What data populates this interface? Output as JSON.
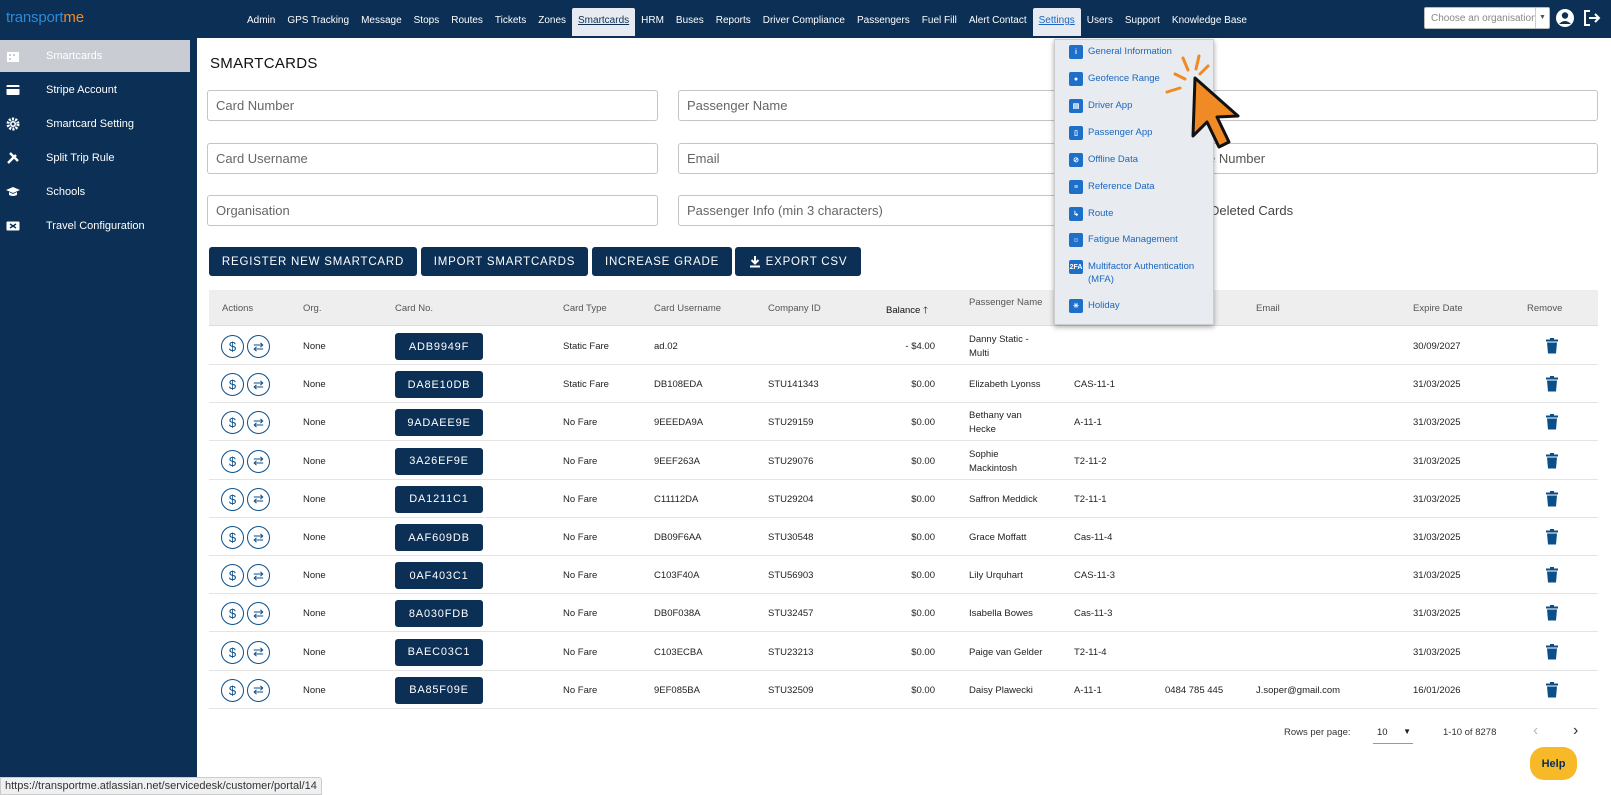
{
  "app": {
    "logo_a": "transport",
    "logo_b": "me"
  },
  "nav": [
    "Admin",
    "GPS Tracking",
    "Message",
    "Stops",
    "Routes",
    "Tickets",
    "Zones",
    "Smartcards",
    "HRM",
    "Buses",
    "Reports",
    "Driver Compliance",
    "Passengers",
    "Fuel Fill",
    "Alert Contact",
    "Settings",
    "Users",
    "Support",
    "Knowledge Base"
  ],
  "org_select": {
    "placeholder": "Choose an organisation"
  },
  "sidebar": [
    {
      "label": "Smartcards",
      "icon": "building-icon"
    },
    {
      "label": "Stripe Account",
      "icon": "credit-card-icon"
    },
    {
      "label": "Smartcard Setting",
      "icon": "gear-icon"
    },
    {
      "label": "Split Trip Rule",
      "icon": "tools-icon"
    },
    {
      "label": "Schools",
      "icon": "graduation-cap-icon"
    },
    {
      "label": "Travel Configuration",
      "icon": "ticket-icon"
    }
  ],
  "page_title": "SMARTCARDS",
  "filters": {
    "card_number": "Card Number",
    "passenger_name": "Passenger Name",
    "card_username": "Card Username",
    "email": "Email",
    "number_suffix": "e Number",
    "organisation": "Organisation",
    "passenger_info": "Passenger Info (min 3 characters)",
    "deleted_cards": "Deleted Cards"
  },
  "buttons": {
    "register": "REGISTER NEW SMARTCARD",
    "import": "IMPORT SMARTCARDS",
    "increase": "INCREASE GRADE",
    "export": "EXPORT CSV"
  },
  "table": {
    "headers": {
      "actions": "Actions",
      "org": "Org.",
      "card_no": "Card No.",
      "card_type": "Card Type",
      "card_username": "Card Username",
      "company_id": "Company ID",
      "balance": "Balance",
      "passenger_name": "Passenger Name",
      "email": "Email",
      "expire_date": "Expire Date",
      "remove": "Remove"
    },
    "rows": [
      {
        "org": "None",
        "card": "ADB9949F",
        "type": "Static Fare",
        "username": "ad.02",
        "company": "",
        "balance": "- $4.00",
        "name": "Danny Static - Multi",
        "grade": "",
        "phone": "",
        "email": "",
        "expire": "30/09/2027"
      },
      {
        "org": "None",
        "card": "DA8E10DB",
        "type": "Static Fare",
        "username": "DB108EDA",
        "company": "STU141343",
        "balance": "$0.00",
        "name": "Elizabeth Lyonss",
        "grade": "CAS-11-1",
        "phone": "",
        "email": "",
        "expire": "31/03/2025"
      },
      {
        "org": "None",
        "card": "9ADAEE9E",
        "type": "No Fare",
        "username": "9EEEDA9A",
        "company": "STU29159",
        "balance": "$0.00",
        "name": "Bethany van Hecke",
        "grade": "A-11-1",
        "phone": "",
        "email": "",
        "expire": "31/03/2025"
      },
      {
        "org": "None",
        "card": "3A26EF9E",
        "type": "No Fare",
        "username": "9EEF263A",
        "company": "STU29076",
        "balance": "$0.00",
        "name": "Sophie Mackintosh",
        "grade": "T2-11-2",
        "phone": "",
        "email": "",
        "expire": "31/03/2025"
      },
      {
        "org": "None",
        "card": "DA1211C1",
        "type": "No Fare",
        "username": "C11112DA",
        "company": "STU29204",
        "balance": "$0.00",
        "name": "Saffron Meddick",
        "grade": "T2-11-1",
        "phone": "",
        "email": "",
        "expire": "31/03/2025"
      },
      {
        "org": "None",
        "card": "AAF609DB",
        "type": "No Fare",
        "username": "DB09F6AA",
        "company": "STU30548",
        "balance": "$0.00",
        "name": "Grace Moffatt",
        "grade": "Cas-11-4",
        "phone": "",
        "email": "",
        "expire": "31/03/2025"
      },
      {
        "org": "None",
        "card": "0AF403C1",
        "type": "No Fare",
        "username": "C103F40A",
        "company": "STU56903",
        "balance": "$0.00",
        "name": "Lily Urquhart",
        "grade": "CAS-11-3",
        "phone": "",
        "email": "",
        "expire": "31/03/2025"
      },
      {
        "org": "None",
        "card": "8A030FDB",
        "type": "No Fare",
        "username": "DB0F038A",
        "company": "STU32457",
        "balance": "$0.00",
        "name": "Isabella Bowes",
        "grade": "Cas-11-3",
        "phone": "",
        "email": "",
        "expire": "31/03/2025"
      },
      {
        "org": "None",
        "card": "BAEC03C1",
        "type": "No Fare",
        "username": "C103ECBA",
        "company": "STU23213",
        "balance": "$0.00",
        "name": "Paige van Gelder",
        "grade": "T2-11-4",
        "phone": "",
        "email": "",
        "expire": "31/03/2025"
      },
      {
        "org": "None",
        "card": "BA85F09E",
        "type": "No Fare",
        "username": "9EF085BA",
        "company": "STU32509",
        "balance": "$0.00",
        "name": "Daisy Plawecki",
        "grade": "A-11-1",
        "phone": "0484 785 445",
        "email": "J.soper@gmail.com",
        "expire": "16/01/2026"
      }
    ]
  },
  "pagination": {
    "rows_label": "Rows per page:",
    "rows_value": "10",
    "range": "1-10 of 8278"
  },
  "help": "Help",
  "status_url": "https://transportme.atlassian.net/servicedesk/customer/portal/14",
  "settings_menu": [
    {
      "label": "General Information",
      "icon": "info-icon"
    },
    {
      "label": "Geofence Range",
      "icon": "map-pin-icon"
    },
    {
      "label": "Driver App",
      "icon": "driver-app-icon"
    },
    {
      "label": "Passenger App",
      "icon": "passenger-app-icon"
    },
    {
      "label": "Offline Data",
      "icon": "offline-icon"
    },
    {
      "label": "Reference Data",
      "icon": "document-icon"
    },
    {
      "label": "Route",
      "icon": "route-icon"
    },
    {
      "label": "Fatigue Management",
      "icon": "fatigue-icon"
    },
    {
      "label": "Multifactor Authentication (MFA)",
      "icon": "mfa-icon",
      "badge": "2FA"
    },
    {
      "label": "Holiday",
      "icon": "holiday-icon"
    }
  ],
  "colors": {
    "navy": "#0b2f55",
    "link": "#1967c2",
    "accent": "#f08a24",
    "help": "#f7b928"
  }
}
